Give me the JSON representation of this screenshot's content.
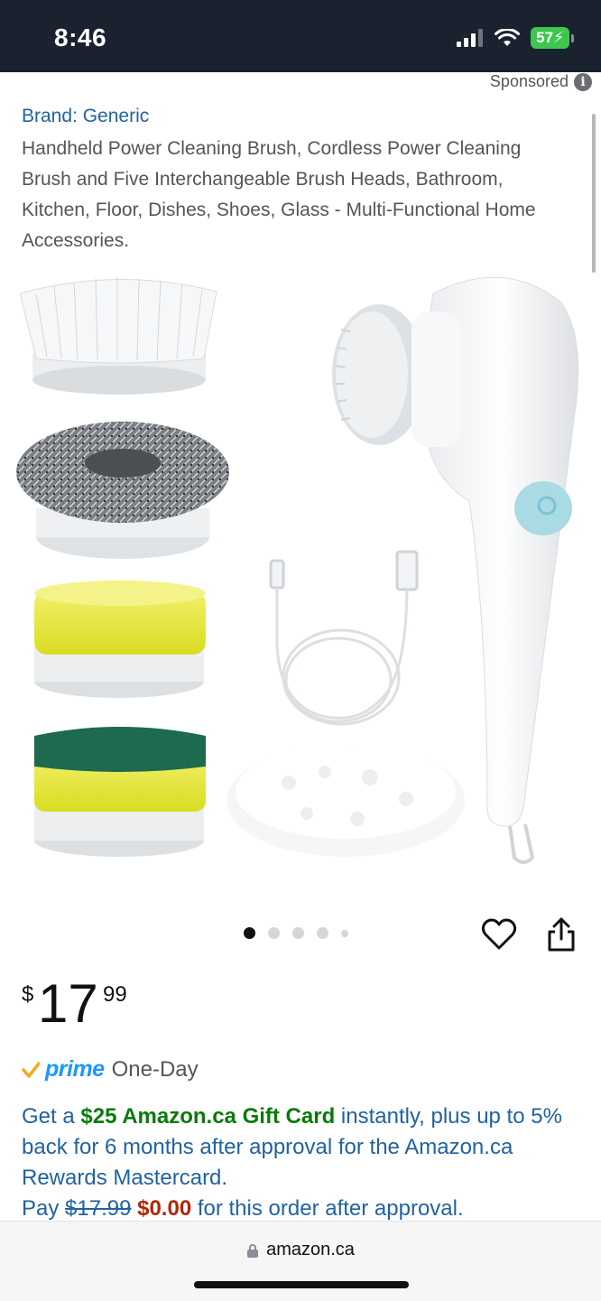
{
  "status_bar": {
    "time": "8:46",
    "battery": "57",
    "icons": [
      "signal-icon",
      "wifi-icon",
      "battery-charging-icon"
    ]
  },
  "listing": {
    "sponsored_label": "Sponsored",
    "brand_link": "Brand: Generic",
    "title": "Handheld Power Cleaning Brush, Cordless Power Cleaning Brush and Five Interchangeable Brush Heads, Bathroom, Kitchen, Floor, Dishes, Shoes, Glass - Multi-Functional Home Accessories."
  },
  "gallery": {
    "image_count": 5,
    "active_index": 0
  },
  "price": {
    "symbol": "$",
    "whole": "17",
    "fraction": "99"
  },
  "prime": {
    "badge": "prime",
    "delivery": "One-Day"
  },
  "offer": {
    "prefix": "Get a ",
    "gift_card": "$25 Amazon.ca Gift Card",
    "middle": " instantly, plus up to 5% back for 6 months after approval for the Amazon.ca Rewards Mastercard.",
    "pay_label": "Pay ",
    "original_price": "$17.99",
    "new_price": "$0.00",
    "suffix": " for this order after approval."
  },
  "browser": {
    "url": "amazon.ca"
  },
  "colors": {
    "link": "#2162a1",
    "prime_blue": "#1a98ff",
    "offer_green": "#0a7a0a",
    "price_red": "#b12704",
    "status_bar_bg": "#1a2230",
    "battery_green": "#3ec650"
  }
}
